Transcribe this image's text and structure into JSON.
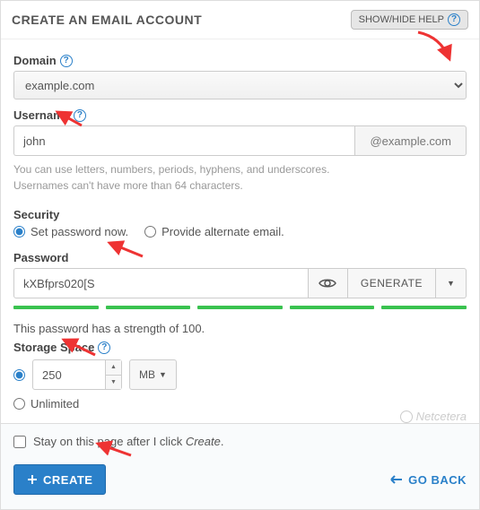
{
  "header": {
    "title": "CREATE AN EMAIL ACCOUNT",
    "help_button": "SHOW/HIDE HELP"
  },
  "domain": {
    "label": "Domain",
    "value": "example.com"
  },
  "username": {
    "label": "Username",
    "value": "john",
    "addon": "@example.com",
    "hint1": "You can use letters, numbers, periods, hyphens, and underscores.",
    "hint2": "Usernames can't have more than 64 characters."
  },
  "security": {
    "label": "Security",
    "opt1": "Set password now.",
    "opt2": "Provide alternate email."
  },
  "password": {
    "label": "Password",
    "value": "kXBfprs020[S",
    "generate": "GENERATE",
    "strength_text": "This password has a strength of 100."
  },
  "storage": {
    "label": "Storage Space",
    "value": "250",
    "unit": "MB",
    "unlimited": "Unlimited"
  },
  "watermark": "Netcetera",
  "footer": {
    "stay_prefix": "Stay on this page after I click ",
    "stay_em": "Create",
    "stay_suffix": ".",
    "create": "CREATE",
    "goback": "GO BACK"
  }
}
